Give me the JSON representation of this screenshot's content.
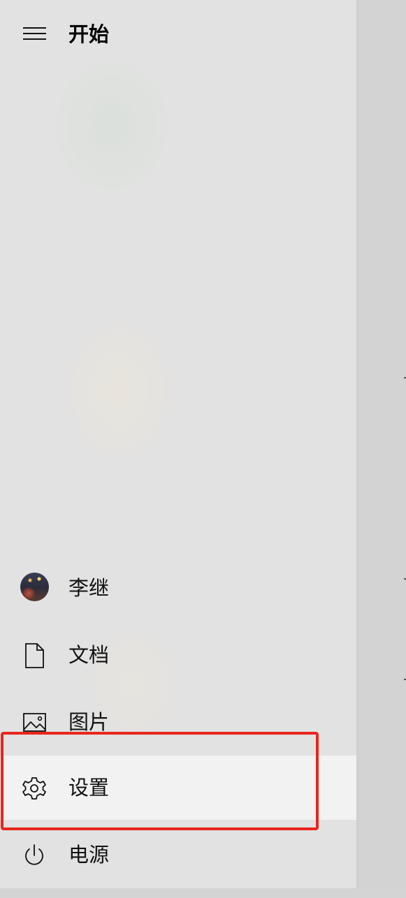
{
  "start_menu": {
    "title": "开始",
    "menu_icon": "hamburger-menu-icon",
    "items": [
      {
        "id": "user",
        "label": "李继",
        "icon": "user-avatar"
      },
      {
        "id": "documents",
        "label": "文档",
        "icon": "document-icon"
      },
      {
        "id": "pictures",
        "label": "图片",
        "icon": "picture-icon"
      },
      {
        "id": "settings",
        "label": "设置",
        "icon": "gear-icon",
        "highlighted": true
      },
      {
        "id": "power",
        "label": "电源",
        "icon": "power-icon"
      }
    ]
  },
  "annotation": {
    "color": "#e8261d",
    "target": "settings"
  },
  "colors": {
    "panel_background": "#e2e2e2",
    "highlight_background": "#f2f2f2",
    "text": "#111111"
  }
}
